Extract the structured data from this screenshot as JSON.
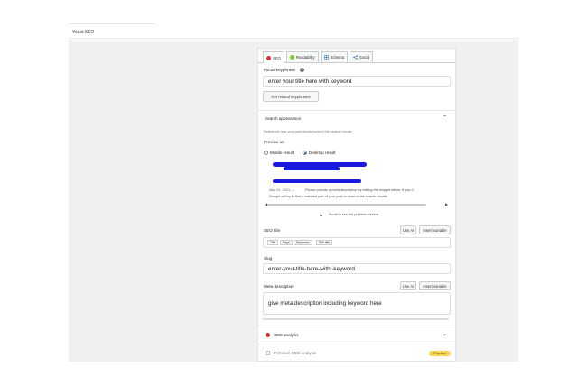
{
  "header": {
    "title": "Yoast SEO"
  },
  "tabs": [
    {
      "label": "SEO",
      "color": "#dc3232"
    },
    {
      "label": "Readability",
      "color": "#7ad03a"
    },
    {
      "label": "Schema",
      "icon": "grid-icon"
    },
    {
      "label": "Social",
      "icon": "share-icon"
    }
  ],
  "focus": {
    "label": "Focus keyphrase",
    "value": "enter your title here with keyword",
    "button": "Get related keyphrases"
  },
  "search_appearance": {
    "label": "Search appearance",
    "hint": "Determine how your post should look in the search results.",
    "preview_as": "Preview as:",
    "mobile": "Mobile result",
    "desktop": "Desktop result",
    "snippet_date": "May 31, 2023 —",
    "snippet_text": "Please provide a meta description by editing the snippet below. If you d",
    "snippet_text2": "Google will try to find a relevant part of your post to show in the search results.",
    "scroll_hint": "Scroll to see the preview content."
  },
  "seo_title": {
    "label": "SEO title",
    "use_ai": "Use AI",
    "insert_variable": "Insert variable",
    "pills": [
      "Title",
      "Page",
      "Separator",
      "Site title"
    ]
  },
  "slug": {
    "label": "Slug",
    "value": "enter-your-title-here-with -keyword"
  },
  "meta": {
    "label": "Meta description",
    "use_ai": "Use AI",
    "insert_variable": "Insert variable",
    "value": "give meta description including keyword here"
  },
  "analysis": {
    "seo_label": "SEO analysis",
    "premium_label": "Premium SEO analysis",
    "premium_badge": "Premium"
  },
  "colors": {
    "red": "#dc3232",
    "green": "#7ad03a",
    "scribble": "#1a1adf",
    "premium": "#fcd34d"
  }
}
